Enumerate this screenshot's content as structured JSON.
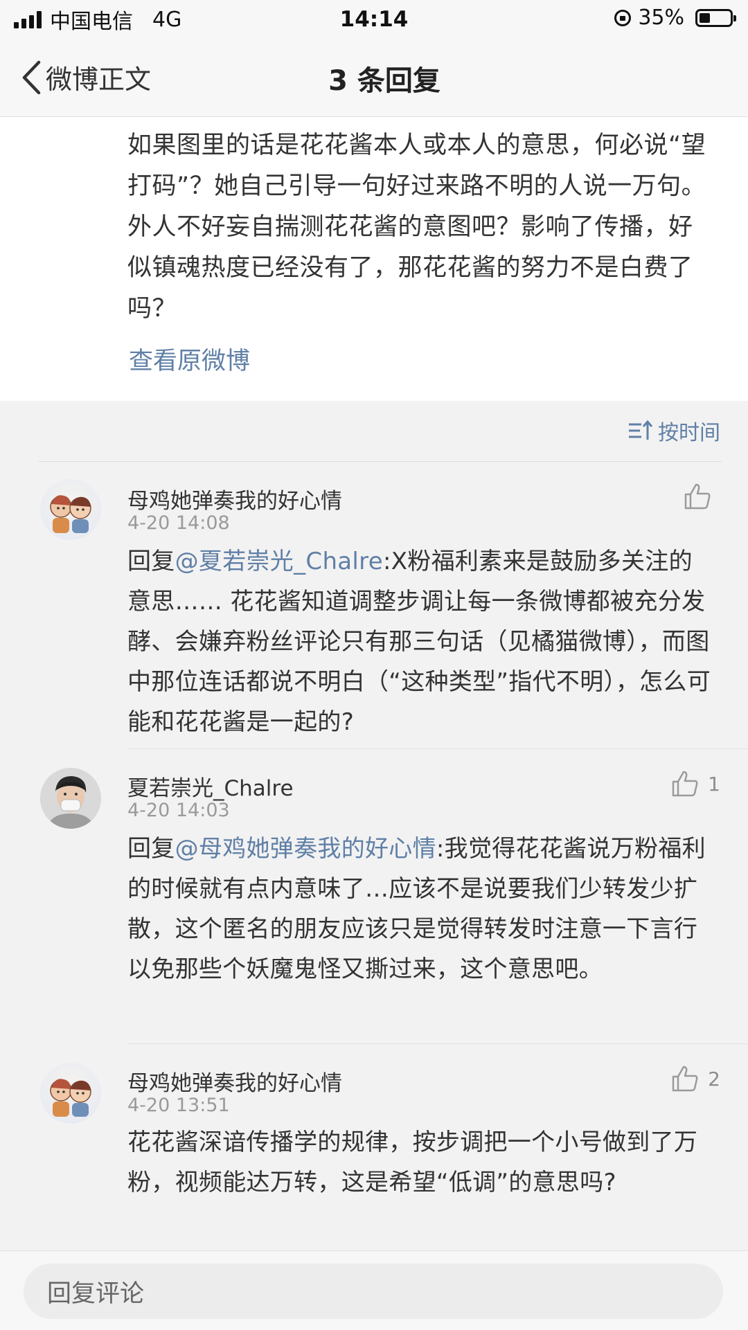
{
  "status_bar": {
    "carrier": "中国电信",
    "network": "4G",
    "time": "14:14",
    "battery": "35%"
  },
  "nav": {
    "back_label": "微博正文",
    "title": "3 条回复"
  },
  "post": {
    "text": "如果图里的话是花花酱本人或本人的意思，何必说“望打码”？她自己引导一句好过来路不明的人说一万句。外人不好妄自揣测花花酱的意图吧？影响了传播，好似镇魂热度已经没有了，那花花酱的努力不是白费了吗？",
    "view_original": "查看原微博"
  },
  "sort": {
    "label": "按时间",
    "icon": "sort-icon"
  },
  "comments": [
    {
      "name": "母鸡她弹奏我的好心情",
      "time": "4-20 14:08",
      "likes": "",
      "reply_prefix": "回复",
      "mention": "@夏若崇光_Chalre",
      "text": ":X粉福利素来是鼓励多关注的意思…… 花花酱知道调整步调让每一条微博都被充分发酵、会嫌弃粉丝评论只有那三句话（见橘猫微博），而图中那位连话都说不明白（“这种类型”指代不明），怎么可能和花花酱是一起的?"
    },
    {
      "name": "夏若崇光_Chalre",
      "time": "4-20 14:03",
      "likes": "1",
      "reply_prefix": "回复",
      "mention": "@母鸡她弹奏我的好心情",
      "text": ":我觉得花花酱说万粉福利的时候就有点内意味了…应该不是说要我们少转发少扩散，这个匿名的朋友应该只是觉得转发时注意一下言行以免那些个妖魔鬼怪又撕过来，这个意思吧。"
    },
    {
      "name": "母鸡她弹奏我的好心情",
      "time": "4-20 13:51",
      "likes": "2",
      "reply_prefix": "",
      "mention": "",
      "text": "花花酱深谙传播学的规律，按步调把一个小号做到了万粉，视频能达万转，这是希望“低调”的意思吗?"
    }
  ],
  "reply_bar": {
    "placeholder": "回复评论"
  },
  "colors": {
    "link": "#5f7fa6",
    "background": "#f2f2f2"
  }
}
